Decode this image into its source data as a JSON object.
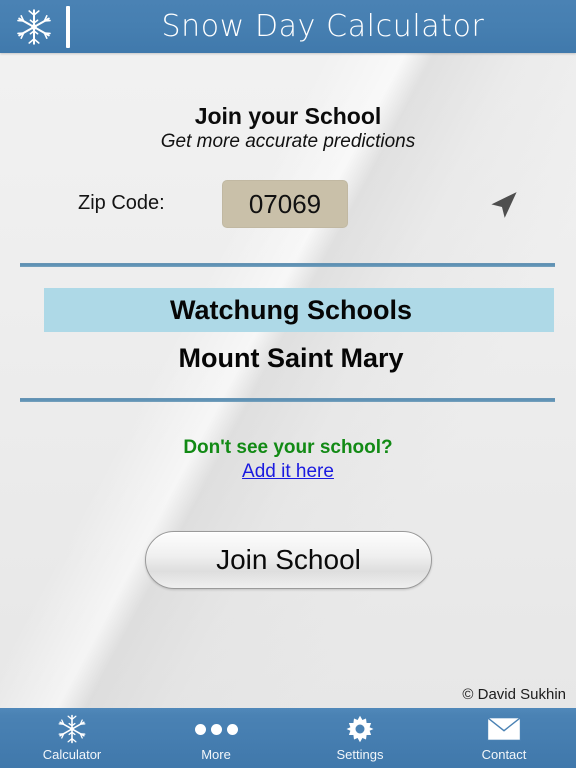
{
  "header": {
    "title": "Snow Day Calculator",
    "snowflake_icon": "snowflake-icon",
    "accent_color": "#467fb1"
  },
  "join": {
    "title": "Join your School",
    "subtitle": "Get more accurate predictions"
  },
  "zip": {
    "label": "Zip Code:",
    "value": "07069",
    "placeholder": "Zip Code",
    "field_color": "#c9c0a9",
    "locate_icon": "location-arrow-icon"
  },
  "schools": {
    "selected_color": "#aed9e7",
    "items": [
      {
        "name": "Watchung Schools",
        "selected": true
      },
      {
        "name": "Mount Saint Mary",
        "selected": false
      }
    ]
  },
  "prompt": {
    "question": "Don't see your school?",
    "question_color": "#128a15",
    "link": "Add it here",
    "link_color": "#1a1ae0"
  },
  "actions": {
    "join_button": "Join School"
  },
  "footer": {
    "copyright": "© David Sukhin"
  },
  "tabbar": {
    "items": [
      {
        "label": "Calculator",
        "icon": "snowflake-icon"
      },
      {
        "label": "More",
        "icon": "ellipsis-icon"
      },
      {
        "label": "Settings",
        "icon": "gear-icon"
      },
      {
        "label": "Contact",
        "icon": "envelope-icon"
      }
    ]
  }
}
